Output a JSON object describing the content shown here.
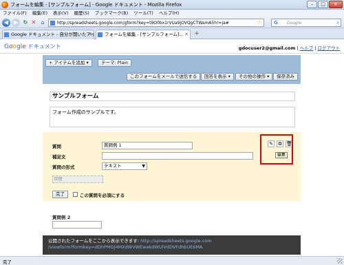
{
  "window": {
    "title": "フォームを編集 - [サンプルフォーム] - Google ドキュメント - Mozilla Firefox",
    "buttons": {
      "minimize": "–",
      "maximize": "□",
      "close": "x"
    }
  },
  "menubar": [
    "ファイル(F)",
    "編集(E)",
    "表示(V)",
    "履歴(S)",
    "ブックマーク(B)",
    "ツール(T)",
    "ヘルプ(H)"
  ],
  "nav": {
    "url": "http://spreadsheets.google.com/gform?key=t9O0bx1rVUa9jOVQgCTWamA5h!=ja#",
    "search_placeholder": "Google",
    "search_engine_glyph": "G"
  },
  "tabs": [
    {
      "label": "Google ドキュメント - 自分が開いたアイ..."
    },
    {
      "label": "フォームを編集 - [サンプルフォーム]..."
    }
  ],
  "header": {
    "logo_letters": [
      "G",
      "o",
      "o",
      "g",
      "l",
      "e"
    ],
    "product": "ドキュメント",
    "email": "gdocuser2@gmail.com",
    "help": "ヘルプ",
    "logout": "ログアウト",
    "sep": "|"
  },
  "toolbar": {
    "add_item": "+ アイテムを追加",
    "theme": "テーマ: Plain",
    "email_form": "このフォームをメールで送信する",
    "view_responses": "回答を表示",
    "more_actions": "その他の操作",
    "saved": "保存済み"
  },
  "form": {
    "title": "サンプルフォーム",
    "description": "フォーム作成のサンプルです。"
  },
  "question": {
    "title_label": "質問",
    "title_value": "質問例 1",
    "help_label": "補足文",
    "help_value": "",
    "type_label": "質問の形式",
    "type_value": "テキスト",
    "answer_placeholder": "回答",
    "done_button": "完了",
    "required_label": "この質問を必須にする",
    "tooltip": "編集"
  },
  "question2": {
    "label": "質問例 2"
  },
  "publish": {
    "text": "公開されたフォームをここから表示できます: ",
    "url_line1": "http://spreadsheets.google.com",
    "url_line2": "/viewform?formkey=dDhPMGJ4MXdWVWEwakdWUlVdDVFdhbUE6MA"
  },
  "status": {
    "text": "完了"
  },
  "colors": {
    "toolbar": "#9cbcd9",
    "question_panel": "#fef6d5",
    "highlight": "#e00000",
    "publish_bar": "#3a3a3a"
  }
}
